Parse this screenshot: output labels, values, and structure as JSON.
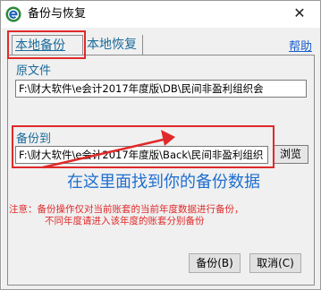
{
  "window": {
    "title": "备份与恢复",
    "close_glyph": "✕"
  },
  "tabs": [
    {
      "label": "本地备份",
      "active": true
    },
    {
      "label": "本地恢复",
      "active": false
    }
  ],
  "help": {
    "label": "帮助"
  },
  "source": {
    "label": "原文件",
    "value": "F:\\财大软件\\e会计2017年度版\\DB\\民间非盈利组织会"
  },
  "backup_to": {
    "label": "备份到",
    "value": "F:\\财大软件\\e会计2017年度版\\Back\\民间非盈利组织",
    "browse_label": "浏览"
  },
  "annotation_text": "在这里面找到你的备份数据",
  "note": {
    "line1": "注意：备份操作仅对当前账套的当前年度数据进行备份，",
    "line2": "不同年度请进入该年度的账套分别备份"
  },
  "buttons": {
    "backup": "备份(B)",
    "cancel": "取消(C)"
  },
  "colors": {
    "highlight_box": "#e02a2a",
    "annotation": "#1f6fd0",
    "note": "#e02a2a",
    "link": "#1a5fd0"
  },
  "icons": {
    "app": "e-logo-icon",
    "close": "close-icon",
    "arrow": "annotation-arrow"
  }
}
